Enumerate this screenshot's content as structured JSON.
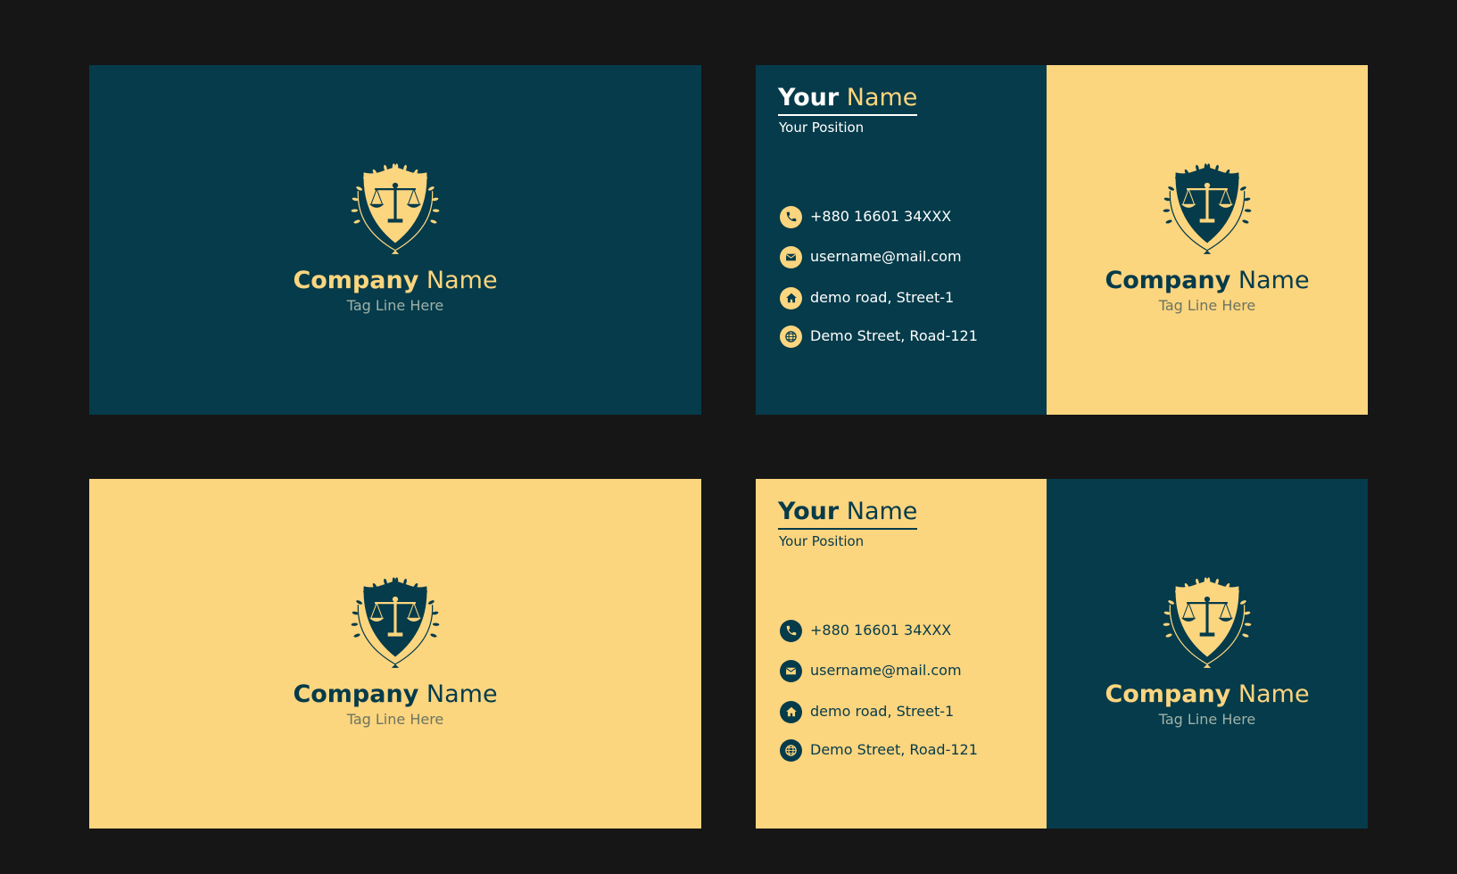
{
  "colors": {
    "teal": "#053b4a",
    "gold": "#fcd57f",
    "background": "#161616"
  },
  "company": {
    "name_bold": "Company",
    "name_light": "Name",
    "tagline": "Tag Line Here"
  },
  "person": {
    "first": "Your",
    "last": "Name",
    "position": "Your Position"
  },
  "contacts": [
    {
      "icon": "phone-icon",
      "text": "+880 16601 34XXX"
    },
    {
      "icon": "mail-icon",
      "text": "username@mail.com"
    },
    {
      "icon": "home-icon",
      "text": "demo road, Street-1"
    },
    {
      "icon": "globe-icon",
      "text": "Demo Street, Road-121"
    }
  ]
}
